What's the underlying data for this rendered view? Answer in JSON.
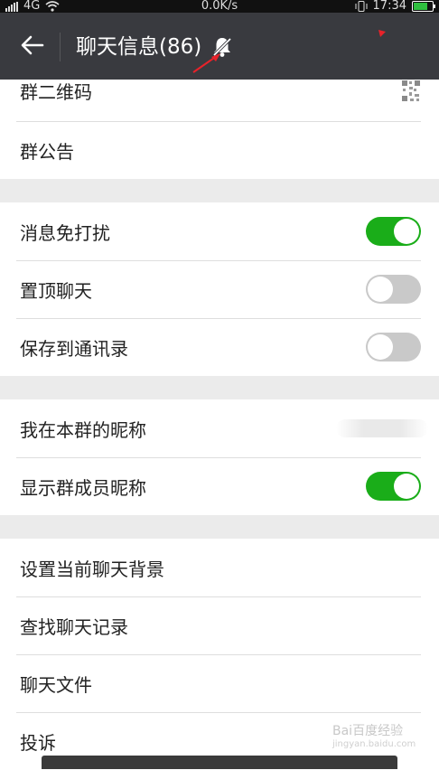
{
  "status_bar": {
    "network": "4G",
    "speed": "0.0K/s",
    "time": "17:34"
  },
  "header": {
    "title": "聊天信息(86)",
    "back_icon": "back-arrow-icon",
    "mute_icon": "bell-off-icon"
  },
  "groups": {
    "info": {
      "qr_label": "群二维码",
      "announcement_label": "群公告"
    },
    "settings": {
      "mute_label": "消息免打扰",
      "mute_on": true,
      "pin_label": "置顶聊天",
      "pin_on": false,
      "save_label": "保存到通讯录",
      "save_on": false
    },
    "nickname": {
      "my_nickname_label": "我在本群的昵称",
      "show_nicknames_label": "显示群成员昵称",
      "show_nicknames_on": true
    },
    "more": {
      "background_label": "设置当前聊天背景",
      "search_label": "查找聊天记录",
      "files_label": "聊天文件",
      "report_label": "投诉"
    }
  },
  "watermark": {
    "text": "Bai百度经验",
    "sub": "jingyan.baidu.com"
  },
  "colors": {
    "title_bar": "#393a3f",
    "toggle_on": "#1aad19",
    "toggle_off": "#c9c9c9",
    "annotation": "#e8222a"
  }
}
